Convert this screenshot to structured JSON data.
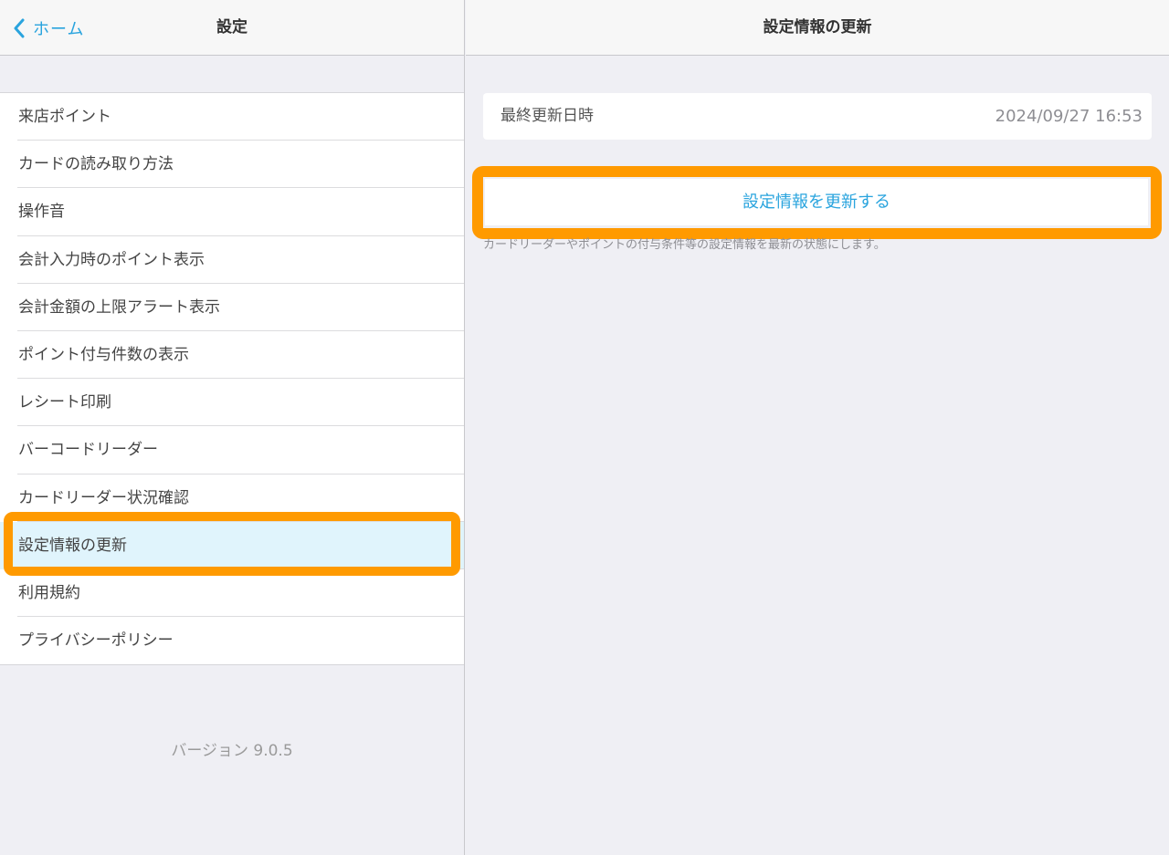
{
  "left_pane": {
    "back_label": "ホーム",
    "title": "設定",
    "menu_items": [
      "来店ポイント",
      "カードの読み取り方法",
      "操作音",
      "会計入力時のポイント表示",
      "会計金額の上限アラート表示",
      "ポイント付与件数の表示",
      "レシート印刷",
      "バーコードリーダー",
      "カードリーダー状況確認",
      "設定情報の更新",
      "利用規約",
      "プライバシーポリシー"
    ],
    "selected_item": "設定情報の更新",
    "version": "バージョン 9.0.5"
  },
  "right_pane": {
    "title": "設定情報の更新",
    "last_update_label": "最終更新日時",
    "last_update_value": "2024/09/27 16:53",
    "update_button_label": "設定情報を更新する",
    "hint": "カードリーダーやポイントの付与条件等の設定情報を最新の状態にします。"
  },
  "colors": {
    "accent": "#2aa4de",
    "highlight": "#ff9a00",
    "selected_row": "#e0f4fc",
    "background": "#efeff4"
  },
  "icons": {
    "back": "chevron-left-icon"
  }
}
